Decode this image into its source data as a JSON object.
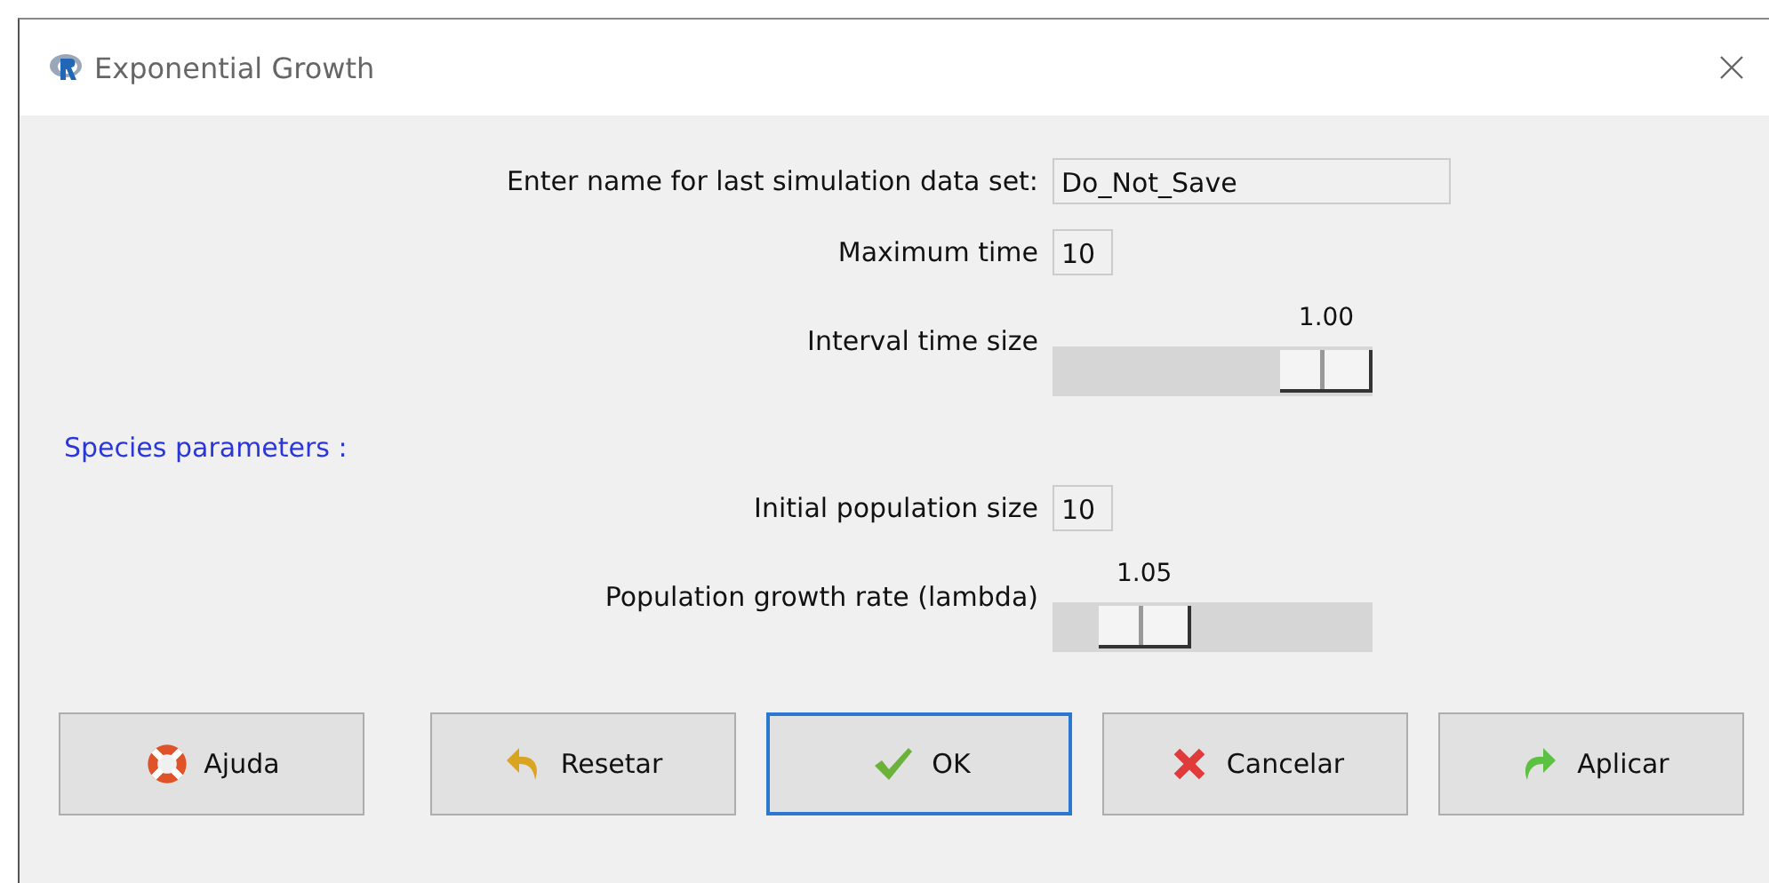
{
  "window": {
    "title": "Exponential Growth"
  },
  "rows": [
    {
      "kind": "field",
      "label": "Enter name for last simulation data set:",
      "value": "Do_Not_Save",
      "wide": true
    },
    {
      "kind": "field",
      "label": "Maximum time",
      "value": "10",
      "wide": false
    },
    {
      "kind": "slider",
      "label": "Interval time size",
      "reading": "1.00",
      "level": 1
    },
    {
      "kind": "section",
      "label": "Species parameters :"
    },
    {
      "kind": "field",
      "label": "Initial population size",
      "value": "10",
      "wide": false
    },
    {
      "kind": "slider",
      "label": "Population growth rate (lambda)",
      "reading": "1.05",
      "level": 0.2
    }
  ],
  "buttons": [
    {
      "label": "Ajuda",
      "focused": false
    },
    {
      "label": "Resetar",
      "focused": false
    },
    {
      "label": "OK",
      "focused": true
    },
    {
      "label": "Cancelar",
      "focused": false
    },
    {
      "label": "Aplicar",
      "focused": false
    }
  ]
}
